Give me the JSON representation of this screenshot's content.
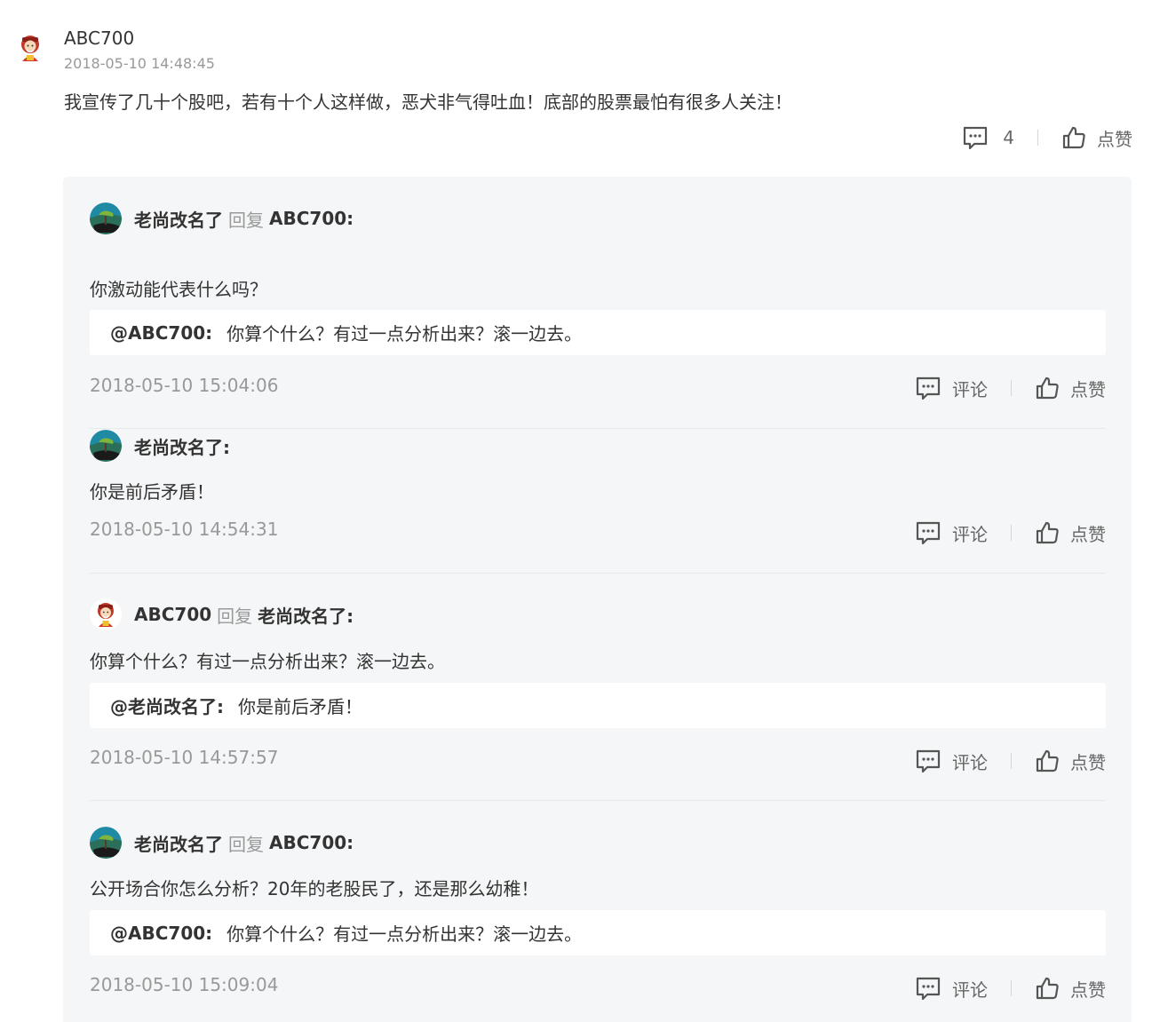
{
  "comment": {
    "user": "ABC700",
    "time": "2018-05-10 14:48:45",
    "text": "我宣传了几十个股吧，若有十个人这样做，恶犬非气得吐血！底部的股票最怕有很多人关注！",
    "reply_count": "4",
    "like_label": "点赞",
    "avatar_icon": "fortune-god-avatar-icon"
  },
  "replies": [
    {
      "user": "老尚改名了",
      "reply_word": "回复",
      "reply_to": "ABC700:",
      "text": "你激动能代表什么吗？",
      "quote_name": "@ABC700:",
      "quote_text": "你算个什么？有过一点分析出来？滚一边去。",
      "time": "2018-05-10 15:04:06",
      "comment_label": "评论",
      "like_label": "点赞"
    },
    {
      "user": "老尚改名了:",
      "text": "你是前后矛盾！",
      "time": "2018-05-10 14:54:31",
      "comment_label": "评论",
      "like_label": "点赞"
    },
    {
      "user": "ABC700",
      "reply_word": "回复",
      "reply_to": "老尚改名了:",
      "text": "你算个什么？有过一点分析出来？滚一边去。",
      "quote_name": "@老尚改名了:",
      "quote_text": "你是前后矛盾！",
      "time": "2018-05-10 14:57:57",
      "comment_label": "评论",
      "like_label": "点赞"
    },
    {
      "user": "老尚改名了",
      "reply_word": "回复",
      "reply_to": "ABC700:",
      "text": "公开场合你怎么分析？20年的老股民了，还是那么幼稚！",
      "quote_name": "@ABC700:",
      "quote_text": "你算个什么？有过一点分析出来？滚一边去。",
      "time": "2018-05-10 15:09:04",
      "comment_label": "评论",
      "like_label": "点赞"
    }
  ],
  "colors": {
    "text": "#333333",
    "muted": "#999999",
    "panel": "#f5f6f7",
    "quote_bg": "#ffffff"
  }
}
